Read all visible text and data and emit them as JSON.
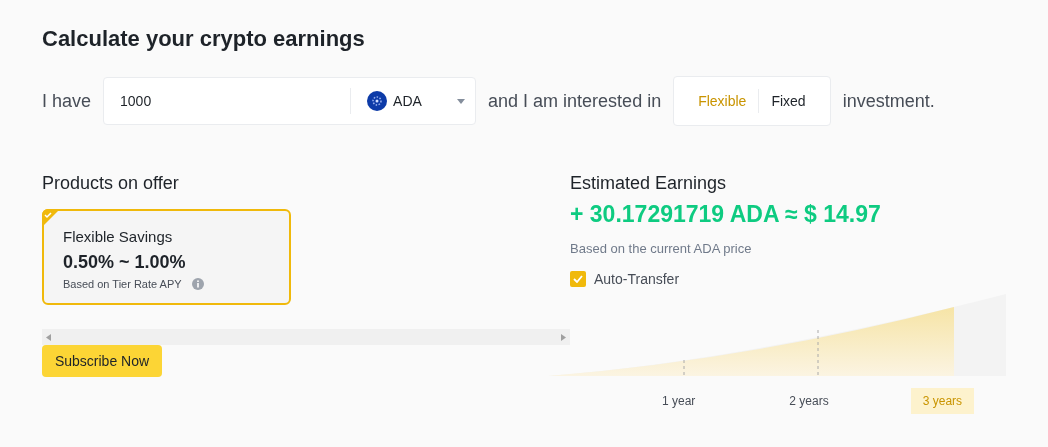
{
  "title": "Calculate your crypto earnings",
  "sentence": {
    "prefix": "I have",
    "amount": "1000",
    "coin": "ADA",
    "middle": "and I am interested in",
    "suffix": "investment."
  },
  "types": [
    {
      "label": "Flexible",
      "selected": true
    },
    {
      "label": "Fixed",
      "selected": false
    }
  ],
  "products": {
    "heading": "Products on offer",
    "items": [
      {
        "name": "Flexible Savings",
        "rate": "0.50% ~ 1.00%",
        "note": "Based on Tier Rate APY",
        "selected": true
      }
    ],
    "button": "Subscribe Now"
  },
  "earnings": {
    "heading": "Estimated Earnings",
    "value": "+ 30.17291719 ADA ≈ $ 14.97",
    "note": "Based on the current ADA price",
    "auto_transfer": {
      "label": "Auto-Transfer",
      "checked": true
    }
  },
  "periods": [
    {
      "label": "1 year",
      "selected": false
    },
    {
      "label": "2 years",
      "selected": false
    },
    {
      "label": "3 years",
      "selected": true
    }
  ]
}
